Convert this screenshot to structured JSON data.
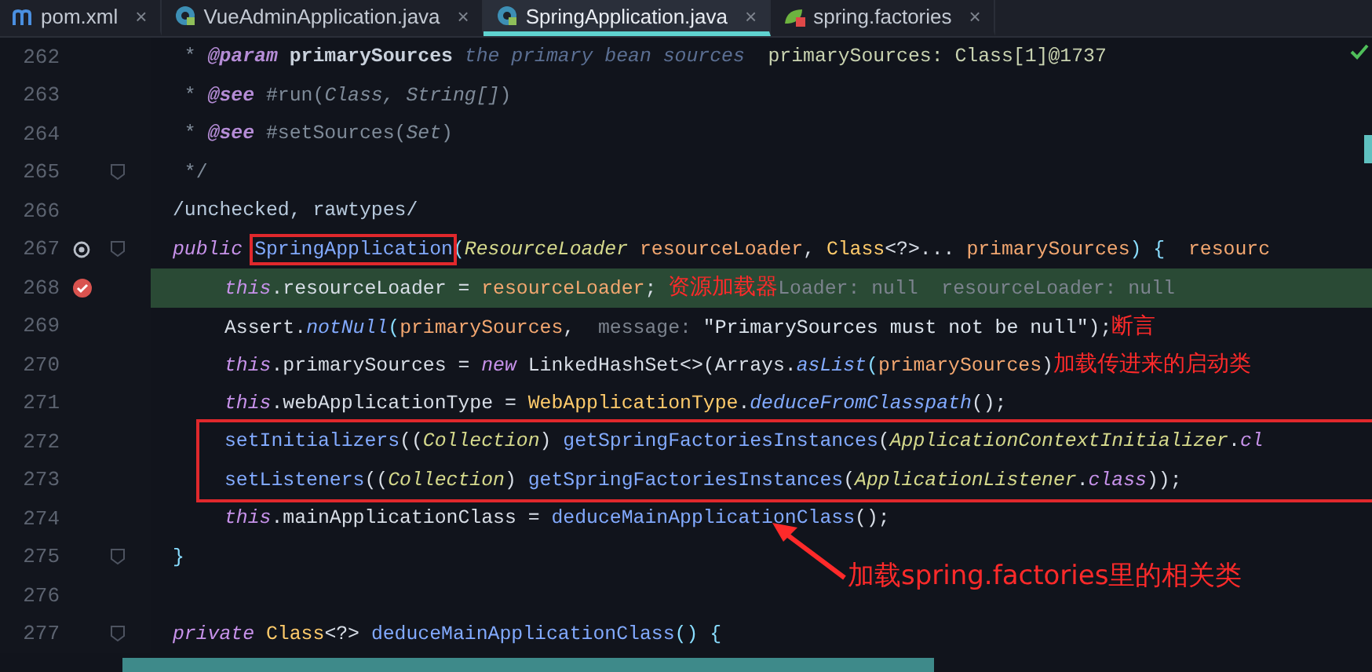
{
  "tabs": [
    {
      "label": "pom.xml",
      "kind": "maven",
      "selected": false,
      "close": "×"
    },
    {
      "label": "VueAdminApplication.java",
      "kind": "java",
      "selected": false,
      "close": "×"
    },
    {
      "label": "SpringApplication.java",
      "kind": "java",
      "selected": true,
      "close": "×"
    },
    {
      "label": "spring.factories",
      "kind": "spring",
      "selected": false,
      "close": "×"
    }
  ],
  "lines": [
    {
      "number": "262",
      "tokens": [
        {
          "text": " * ",
          "kind": "doc"
        },
        {
          "text": "@param",
          "kind": "dtag"
        },
        {
          "text": " primarySources",
          "kind": "dname"
        },
        {
          "text": " the primary bean sources",
          "kind": "dit"
        },
        {
          "text": "  primarySources: Class[1]@1737",
          "kind": "value"
        }
      ]
    },
    {
      "number": "263",
      "tokens": [
        {
          "text": " * ",
          "kind": "doc"
        },
        {
          "text": "@see",
          "kind": "dtag"
        },
        {
          "text": " #run(",
          "kind": "doc"
        },
        {
          "text": "Class, String[]",
          "kind": "ditg"
        },
        {
          "text": ")",
          "kind": "doc"
        }
      ]
    },
    {
      "number": "264",
      "tokens": [
        {
          "text": " * ",
          "kind": "doc"
        },
        {
          "text": "@see",
          "kind": "dtag"
        },
        {
          "text": " #setSources(",
          "kind": "doc"
        },
        {
          "text": "Set",
          "kind": "ditg"
        },
        {
          "text": ")",
          "kind": "doc"
        }
      ]
    },
    {
      "number": "265",
      "fold": true,
      "tokens": [
        {
          "text": " */",
          "kind": "doc"
        }
      ]
    },
    {
      "number": "266",
      "tokens": [
        {
          "text": "/unchecked, rawtypes/",
          "kind": "ann"
        }
      ]
    },
    {
      "number": "267",
      "fold": true,
      "gutter_icon": {
        "kind": "override"
      },
      "tokens": [
        {
          "text": "public ",
          "kind": "kw"
        },
        {
          "text": "SpringApplication",
          "kind": "method",
          "boxed": true
        },
        {
          "text": "(",
          "kind": "punct"
        },
        {
          "text": "ResourceLoader",
          "kind": "type"
        },
        {
          "text": " resourceLoader",
          "kind": "param"
        },
        {
          "text": ", ",
          "kind": "plain"
        },
        {
          "text": "Class",
          "kind": "cls"
        },
        {
          "text": "<?>... ",
          "kind": "plain"
        },
        {
          "text": "primarySources",
          "kind": "param"
        },
        {
          "text": ") {",
          "kind": "punct"
        },
        {
          "text": "  resourc",
          "kind": "param"
        }
      ]
    },
    {
      "number": "268",
      "gutter_icon": {
        "kind": "breakpoint"
      },
      "highlighted": true,
      "indented": true,
      "tokens": [
        {
          "text": "this",
          "kind": "kw"
        },
        {
          "text": ".resourceLoader = ",
          "kind": "plain"
        },
        {
          "text": "resourceLoader",
          "kind": "param"
        },
        {
          "text": "; ",
          "kind": "plain"
        },
        {
          "text": "资源加载器",
          "kind": "note"
        },
        {
          "text": "Loader: null  resourceLoader: null",
          "kind": "hint"
        }
      ]
    },
    {
      "number": "269",
      "indented": true,
      "tokens": [
        {
          "text": "Assert.",
          "kind": "plain"
        },
        {
          "text": "notNull",
          "kind": "smethod"
        },
        {
          "text": "(",
          "kind": "punct"
        },
        {
          "text": "primarySources",
          "kind": "param"
        },
        {
          "text": ",  ",
          "kind": "plain"
        },
        {
          "text": "message:",
          "kind": "hint"
        },
        {
          "text": " \"PrimarySources must not be null\"",
          "kind": "str"
        },
        {
          "text": ");",
          "kind": "plain"
        },
        {
          "text": "断言",
          "kind": "note"
        }
      ]
    },
    {
      "number": "270",
      "indented": true,
      "tokens": [
        {
          "text": "this",
          "kind": "kw"
        },
        {
          "text": ".primarySources = ",
          "kind": "plain"
        },
        {
          "text": "new ",
          "kind": "kw"
        },
        {
          "text": "LinkedHashSet<>(Arrays.",
          "kind": "plain"
        },
        {
          "text": "asList",
          "kind": "smethod"
        },
        {
          "text": "(",
          "kind": "punct"
        },
        {
          "text": "primarySources",
          "kind": "param"
        },
        {
          "text": ")",
          "kind": "plain"
        },
        {
          "text": "加载传进来的启动类",
          "kind": "note"
        }
      ]
    },
    {
      "number": "271",
      "indented": true,
      "tokens": [
        {
          "text": "this",
          "kind": "kw"
        },
        {
          "text": ".webApplicationType = ",
          "kind": "plain"
        },
        {
          "text": "WebApplicationType",
          "kind": "cls"
        },
        {
          "text": ".",
          "kind": "plain"
        },
        {
          "text": "deduceFromClasspath",
          "kind": "smethod"
        },
        {
          "text": "();",
          "kind": "plain"
        }
      ]
    },
    {
      "number": "272",
      "boxed": true,
      "tokens": [
        {
          "text": "setInitializers",
          "kind": "method"
        },
        {
          "text": "((",
          "kind": "plain"
        },
        {
          "text": "Collection",
          "kind": "type"
        },
        {
          "text": ") ",
          "kind": "plain"
        },
        {
          "text": "getSpringFactoriesInstances",
          "kind": "method"
        },
        {
          "text": "(",
          "kind": "plain"
        },
        {
          "text": "ApplicationContextInitializer",
          "kind": "type"
        },
        {
          "text": ".",
          "kind": "plain"
        },
        {
          "text": "cl",
          "kind": "kw"
        }
      ]
    },
    {
      "number": "273",
      "boxed": true,
      "tokens": [
        {
          "text": "setListeners",
          "kind": "method"
        },
        {
          "text": "((",
          "kind": "plain"
        },
        {
          "text": "Collection",
          "kind": "type"
        },
        {
          "text": ") ",
          "kind": "plain"
        },
        {
          "text": "getSpringFactoriesInstances",
          "kind": "method"
        },
        {
          "text": "(",
          "kind": "plain"
        },
        {
          "text": "ApplicationListener",
          "kind": "type"
        },
        {
          "text": ".",
          "kind": "plain"
        },
        {
          "text": "class",
          "kind": "kw"
        },
        {
          "text": "));",
          "kind": "plain"
        }
      ]
    },
    {
      "number": "274",
      "indented": true,
      "tokens": [
        {
          "text": "this",
          "kind": "kw"
        },
        {
          "text": ".mainApplicationClass = ",
          "kind": "plain"
        },
        {
          "text": "deduceMainApplicationClass",
          "kind": "method"
        },
        {
          "text": "();",
          "kind": "plain"
        }
      ]
    },
    {
      "number": "275",
      "fold": true,
      "tokens": [
        {
          "text": "}",
          "kind": "punct"
        }
      ]
    },
    {
      "number": "276"
    },
    {
      "number": "277",
      "fold": true,
      "tokens": [
        {
          "text": "private ",
          "kind": "kw"
        },
        {
          "text": "Class",
          "kind": "cls"
        },
        {
          "text": "<?> ",
          "kind": "plain"
        },
        {
          "text": "deduceMainApplicationClass",
          "kind": "method"
        },
        {
          "text": "() {",
          "kind": "punct"
        }
      ]
    }
  ],
  "callout": {
    "text": "加载spring.factories里的相关类"
  }
}
